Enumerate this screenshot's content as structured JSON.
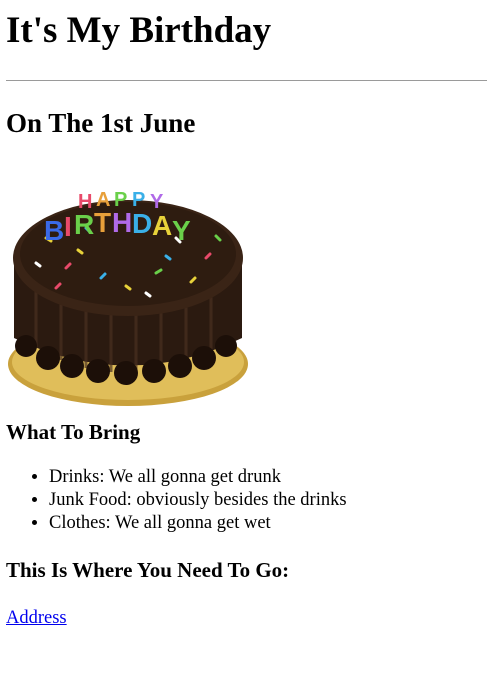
{
  "title": "It's My Birthday",
  "date_heading": "On The 1st June",
  "cake_image": {
    "icon": "birthday-cake-icon",
    "candle_text": "HAPPY BIRTHDAY"
  },
  "bring_section": {
    "heading": "What To Bring",
    "items": [
      "Drinks: We all gonna get drunk",
      "Junk Food: obviously besides the drinks",
      "Clothes: We all gonna get wet"
    ]
  },
  "location_section": {
    "heading": "This Is Where You Need To Go:",
    "link_label": "Address"
  },
  "colors": {
    "link": "#0000ee",
    "divider": "#9a9a9a",
    "text": "#000000"
  }
}
